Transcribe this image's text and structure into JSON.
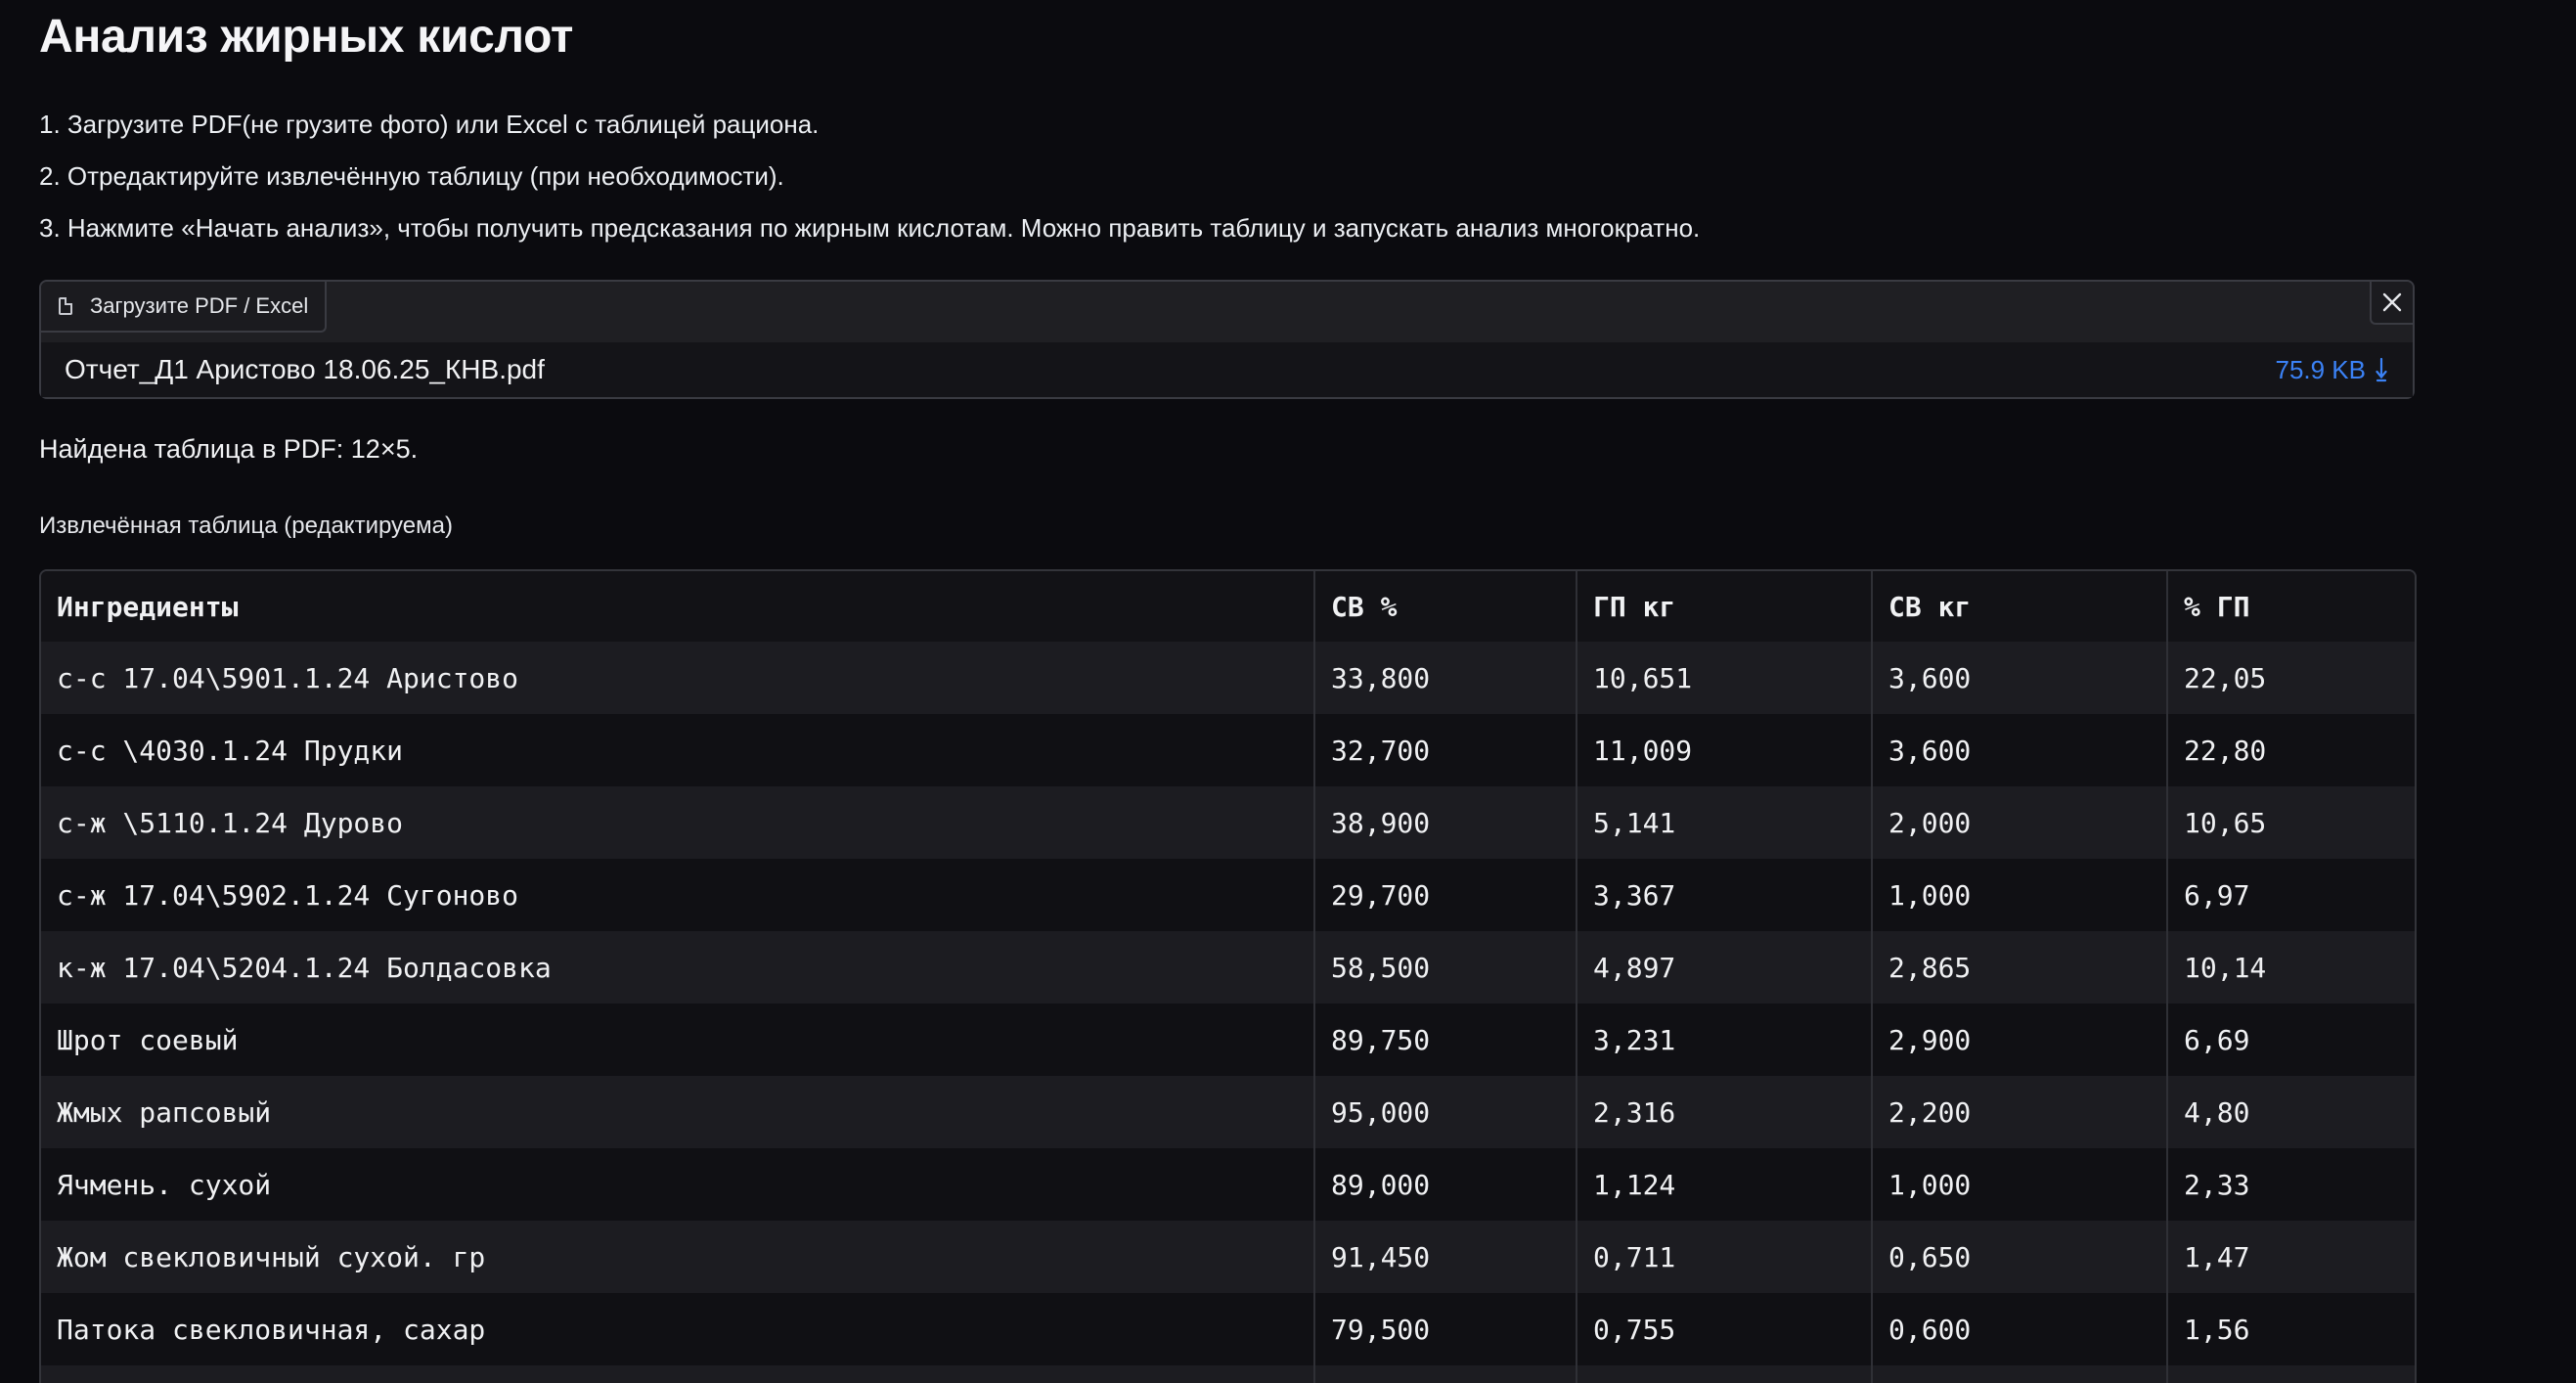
{
  "page": {
    "title": "Анализ жирных кислот",
    "steps": [
      "1. Загрузите PDF(не грузите фото) или Excel с таблицей рациона.",
      "2. Отредактируйте извлечённую таблицу (при необходимости).",
      "3. Нажмите «Начать анализ», чтобы получить предсказания по жирным кислотам. Можно править таблицу и запускать анализ многократно."
    ]
  },
  "upload": {
    "label": "Загрузите PDF / Excel",
    "label_icon": "file-icon",
    "close_icon": "close-icon",
    "file_name": "Отчет_Д1 Аристово 18.06.25_КНВ.pdf",
    "file_size": "75.9 KB",
    "download_icon": "download-icon",
    "accent_color": "#3b82f6"
  },
  "status": {
    "found_text": "Найдена таблица в PDF: 12×5."
  },
  "table": {
    "label": "Извлечённая таблица (редактируема)",
    "headers": [
      "Ингредиенты",
      "СВ %",
      "ГП кг",
      "СВ кг",
      "% ГП"
    ],
    "rows": [
      [
        "с-с 17.04\\5901.1.24 Аристово",
        "33,800",
        "10,651",
        "3,600",
        "22,05"
      ],
      [
        "с-с \\4030.1.24 Прудки",
        "32,700",
        "11,009",
        "3,600",
        "22,80"
      ],
      [
        "с-ж \\5110.1.24 Дурово",
        "38,900",
        "5,141",
        "2,000",
        "10,65"
      ],
      [
        "с-ж 17.04\\5902.1.24 Сугоново",
        "29,700",
        "3,367",
        "1,000",
        "6,97"
      ],
      [
        "к-ж 17.04\\5204.1.24 Болдасовка",
        "58,500",
        "4,897",
        "2,865",
        "10,14"
      ],
      [
        "Шрот соевый",
        "89,750",
        "3,231",
        "2,900",
        "6,69"
      ],
      [
        "Жмых рапсовый",
        "95,000",
        "2,316",
        "2,200",
        "4,80"
      ],
      [
        "Ячмень. сухой",
        "89,000",
        "1,124",
        "1,000",
        "2,33"
      ],
      [
        "Жом свекловичный сухой. гр",
        "91,450",
        "0,711",
        "0,650",
        "1,47"
      ],
      [
        "Патока свекловичная, сахар",
        "79,500",
        "0,755",
        "0,600",
        "1,56"
      ]
    ]
  }
}
